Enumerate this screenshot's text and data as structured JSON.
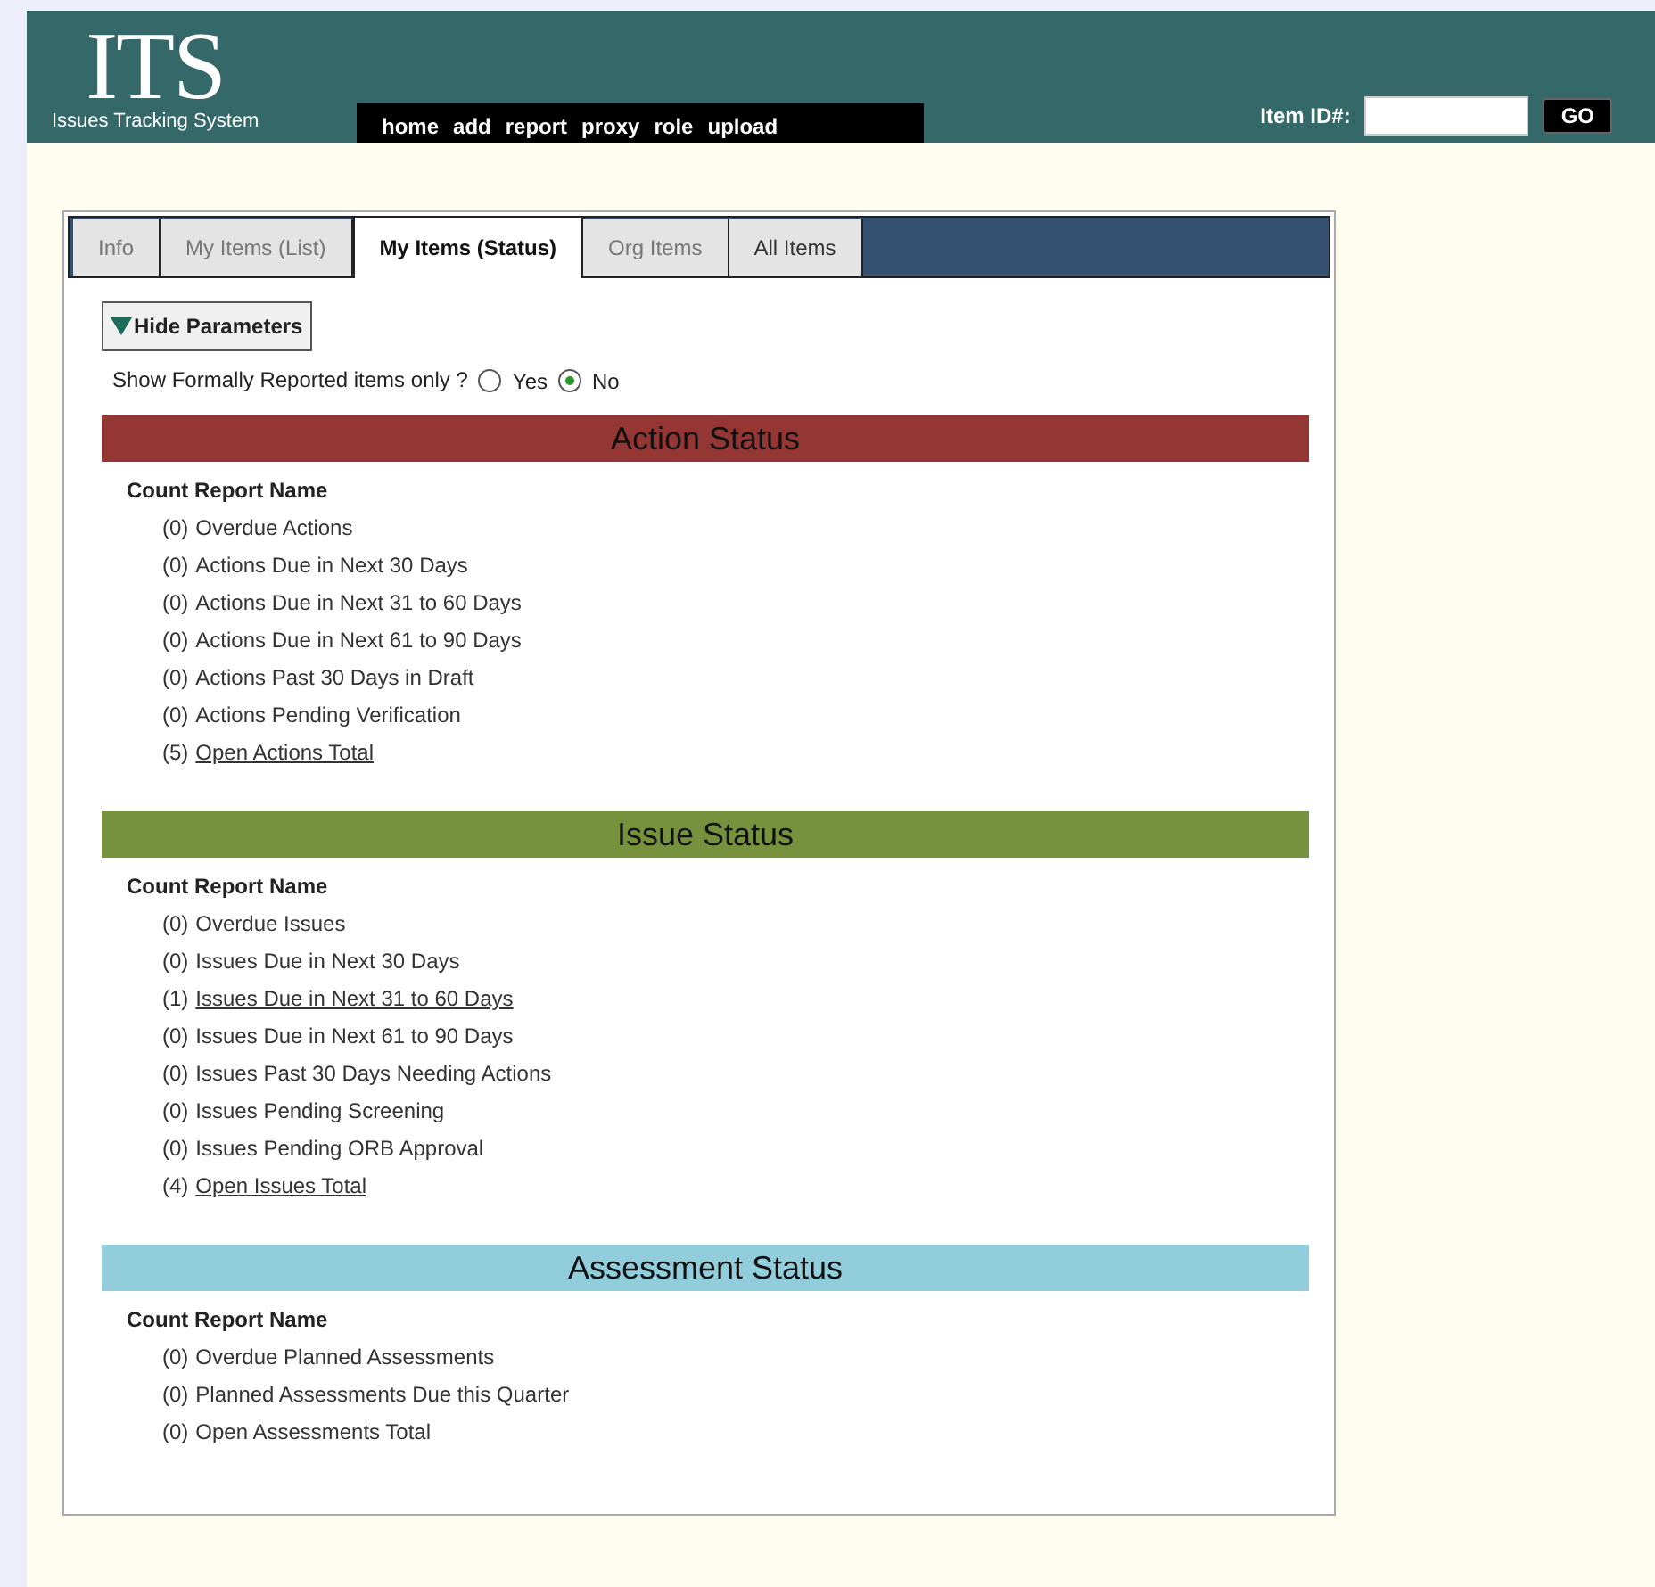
{
  "header": {
    "logo": "ITS",
    "subtitle": "Issues Tracking System",
    "nav": [
      "home",
      "add",
      "report",
      "proxy",
      "role",
      "upload"
    ],
    "item_id_label": "Item ID#:",
    "go_button": "GO"
  },
  "tabs": [
    {
      "label": "Info",
      "selected": false
    },
    {
      "label": "My Items (List)",
      "selected": false
    },
    {
      "label": "My Items (Status)",
      "selected": true
    },
    {
      "label": "Org Items",
      "selected": false
    },
    {
      "label": "All Items",
      "selected": false,
      "dark": true
    }
  ],
  "toggle": {
    "label": "Hide Parameters",
    "expanded": true
  },
  "filter": {
    "label": "Show Formally Reported items only ?",
    "options": [
      {
        "label": "Yes",
        "selected": false
      },
      {
        "label": "No",
        "selected": true
      }
    ]
  },
  "sections": [
    {
      "title": "Action Status",
      "color": "#943634",
      "column_header": "Count Report Name",
      "rows": [
        {
          "count": "(0)",
          "name": "Overdue Actions",
          "link": false
        },
        {
          "count": "(0)",
          "name": "Actions Due in Next 30 Days",
          "link": false
        },
        {
          "count": "(0)",
          "name": "Actions Due in Next 31 to 60 Days",
          "link": false
        },
        {
          "count": "(0)",
          "name": "Actions Due in Next 61 to 90 Days",
          "link": false
        },
        {
          "count": "(0)",
          "name": "Actions Past 30 Days in Draft",
          "link": false
        },
        {
          "count": "(0)",
          "name": "Actions Pending Verification",
          "link": false
        },
        {
          "count": "(5)",
          "name": "Open Actions Total",
          "link": true
        }
      ]
    },
    {
      "title": "Issue Status",
      "color": "#76923c",
      "column_header": "Count Report Name",
      "rows": [
        {
          "count": "(0)",
          "name": "Overdue Issues",
          "link": false
        },
        {
          "count": "(0)",
          "name": "Issues Due in Next 30 Days",
          "link": false
        },
        {
          "count": "(1)",
          "name": "Issues Due in Next 31 to 60 Days",
          "link": true
        },
        {
          "count": "(0)",
          "name": "Issues Due in Next 61 to 90 Days",
          "link": false
        },
        {
          "count": "(0)",
          "name": "Issues Past 30 Days Needing Actions",
          "link": false
        },
        {
          "count": "(0)",
          "name": "Issues Pending Screening",
          "link": false
        },
        {
          "count": "(0)",
          "name": "Issues Pending ORB Approval",
          "link": false
        },
        {
          "count": "(4)",
          "name": "Open Issues Total",
          "link": true
        }
      ]
    },
    {
      "title": "Assessment Status",
      "color": "#92cddc",
      "column_header": "Count Report Name",
      "rows": [
        {
          "count": "(0)",
          "name": "Overdue Planned Assessments",
          "link": false
        },
        {
          "count": "(0)",
          "name": "Planned Assessments Due this Quarter",
          "link": false
        },
        {
          "count": "(0)",
          "name": "Open Assessments Total",
          "link": false
        }
      ]
    }
  ]
}
